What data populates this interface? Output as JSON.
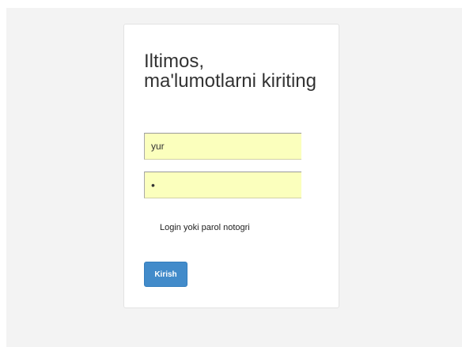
{
  "login": {
    "title": "Iltimos, ma'lumotlarni kiriting",
    "username_value": "yur",
    "password_value": "•",
    "error_message": "Login yoki parol notogri",
    "submit_label": "Kirish"
  },
  "colors": {
    "background": "#f3f3f3",
    "card": "#ffffff",
    "autofill_field": "#fbffbd",
    "button": "#428bca"
  }
}
